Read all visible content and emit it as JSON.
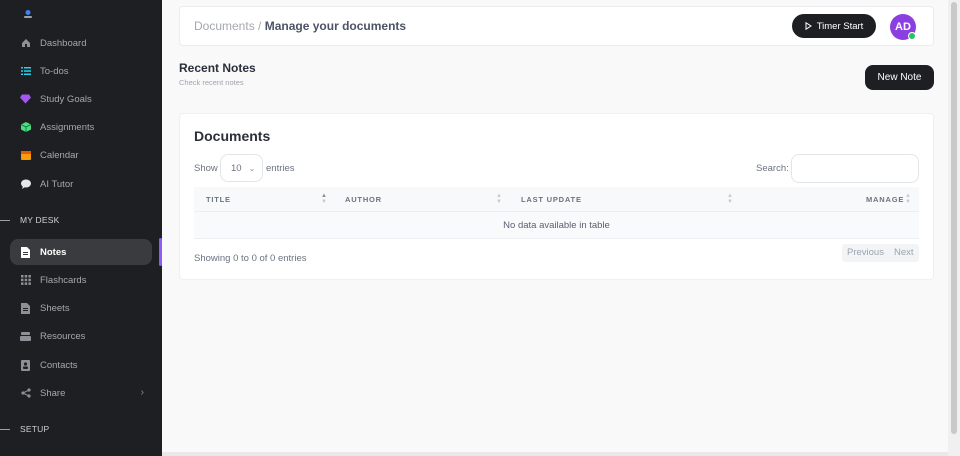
{
  "sidebar": {
    "items": [
      {
        "label": "Dashboard",
        "icon": "home-icon",
        "color": "#8d9096"
      },
      {
        "label": "To-dos",
        "icon": "list-icon",
        "color": "#22d3ee"
      },
      {
        "label": "Study Goals",
        "icon": "diamond-icon",
        "color": "#a855f7"
      },
      {
        "label": "Assignments",
        "icon": "cube-icon",
        "color": "#4ade80"
      },
      {
        "label": "Calendar",
        "icon": "calendar-icon",
        "color": "#f59e0b"
      },
      {
        "label": "AI Tutor",
        "icon": "chat-bubble-icon",
        "color": "#e5e7eb"
      }
    ],
    "section_my_desk": "MY DESK",
    "desk_items": [
      {
        "label": "Notes",
        "icon": "note-icon",
        "active": true
      },
      {
        "label": "Flashcards",
        "icon": "grid-icon"
      },
      {
        "label": "Sheets",
        "icon": "sheet-icon"
      },
      {
        "label": "Resources",
        "icon": "stack-icon"
      },
      {
        "label": "Contacts",
        "icon": "contact-card-icon"
      },
      {
        "label": "Share",
        "icon": "share-icon",
        "chevron": "›"
      }
    ],
    "section_setup": "SETUP"
  },
  "header": {
    "breadcrumb_parent": "Documents",
    "breadcrumb_separator": " / ",
    "breadcrumb_current": "Manage your documents",
    "timer_button": "Timer Start",
    "avatar_initials": "AD"
  },
  "recent": {
    "title": "Recent Notes",
    "subtitle": "Check recent notes",
    "new_button": "New Note"
  },
  "documents": {
    "title": "Documents",
    "show_label": "Show",
    "page_size": "10",
    "entries_label": "entries",
    "search_label": "Search:",
    "search_placeholder": "",
    "columns": [
      "TITLE",
      "AUTHOR",
      "LAST UPDATE",
      "MANAGE"
    ],
    "empty_message": "No data available in table",
    "info": "Showing 0 to 0 of 0 entries",
    "prev": "Previous",
    "next": "Next"
  },
  "colors": {
    "accent": "#8b5cf6",
    "sidebar_bg": "#1e1f22",
    "avatar_bg": "#8b3fe0",
    "online": "#22c55e"
  }
}
